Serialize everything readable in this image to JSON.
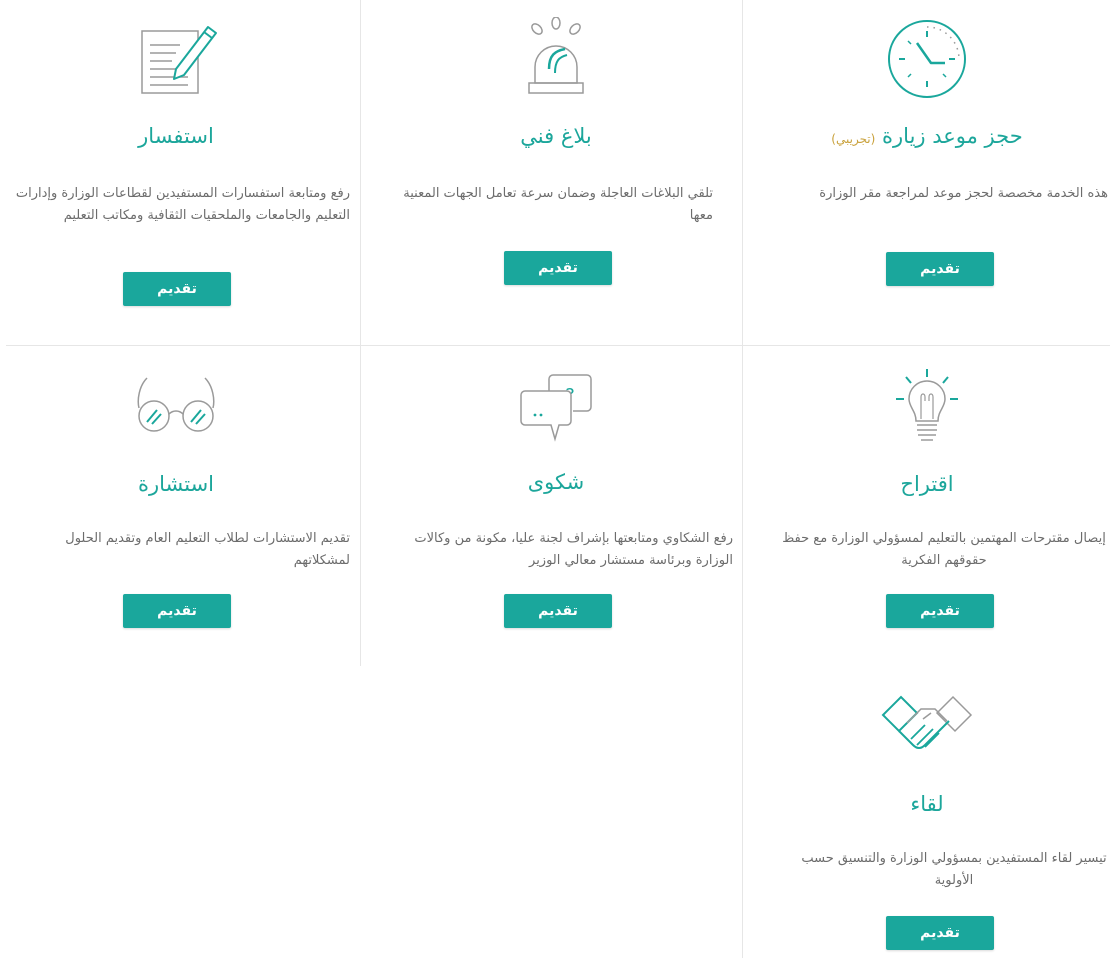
{
  "cards": [
    {
      "id": "visit",
      "title": "حجز موعد زيارة",
      "tag": "(تجريبي)",
      "desc": "هذه الخدمة مخصصة لحجز موعد لمراجعة مقر الوزارة",
      "button": "تقديم",
      "icon": "clock-icon"
    },
    {
      "id": "report",
      "title": "بلاغ فني",
      "desc": "تلقي البلاغات العاجلة وضمان سرعة تعامل الجهات المعنية معها",
      "button": "تقديم",
      "icon": "alarm-light-icon"
    },
    {
      "id": "inquiry",
      "title": "استفسار",
      "desc": "رفع ومتابعة استفسارات المستفيدين لقطاعات الوزارة وإدارات التعليم والجامعات والملحقيات الثقافية ومكاتب التعليم",
      "button": "تقديم",
      "icon": "document-pen-icon"
    },
    {
      "id": "suggestion",
      "title": "اقتراح",
      "desc": "إيصال مقترحات المهتمين بالتعليم لمسؤولي الوزارة مع حفظ حقوقهم الفكرية",
      "button": "تقديم",
      "icon": "lightbulb-icon"
    },
    {
      "id": "complaint",
      "title": "شكوى",
      "desc": "رفع الشكاوي ومتابعتها بإشراف لجنة عليا، مكونة من وكالات الوزارة وبرئاسة مستشار معالي الوزير",
      "button": "تقديم",
      "icon": "chat-question-icon"
    },
    {
      "id": "consultation",
      "title": "استشارة",
      "desc": "تقديم الاستشارات لطلاب التعليم العام وتقديم الحلول لمشكلاتهم",
      "button": "تقديم",
      "icon": "glasses-icon"
    },
    {
      "id": "meeting",
      "title": "لقاء",
      "desc": "تيسير لقاء المستفيدين بمسؤولي الوزارة والتنسيق حسب الأولوية",
      "button": "تقديم",
      "icon": "handshake-icon"
    }
  ],
  "colors": {
    "accent": "#1aa79c",
    "tag": "#c9a13b",
    "text": "#6c6c6c",
    "icon_gray": "#9a9a9a"
  }
}
